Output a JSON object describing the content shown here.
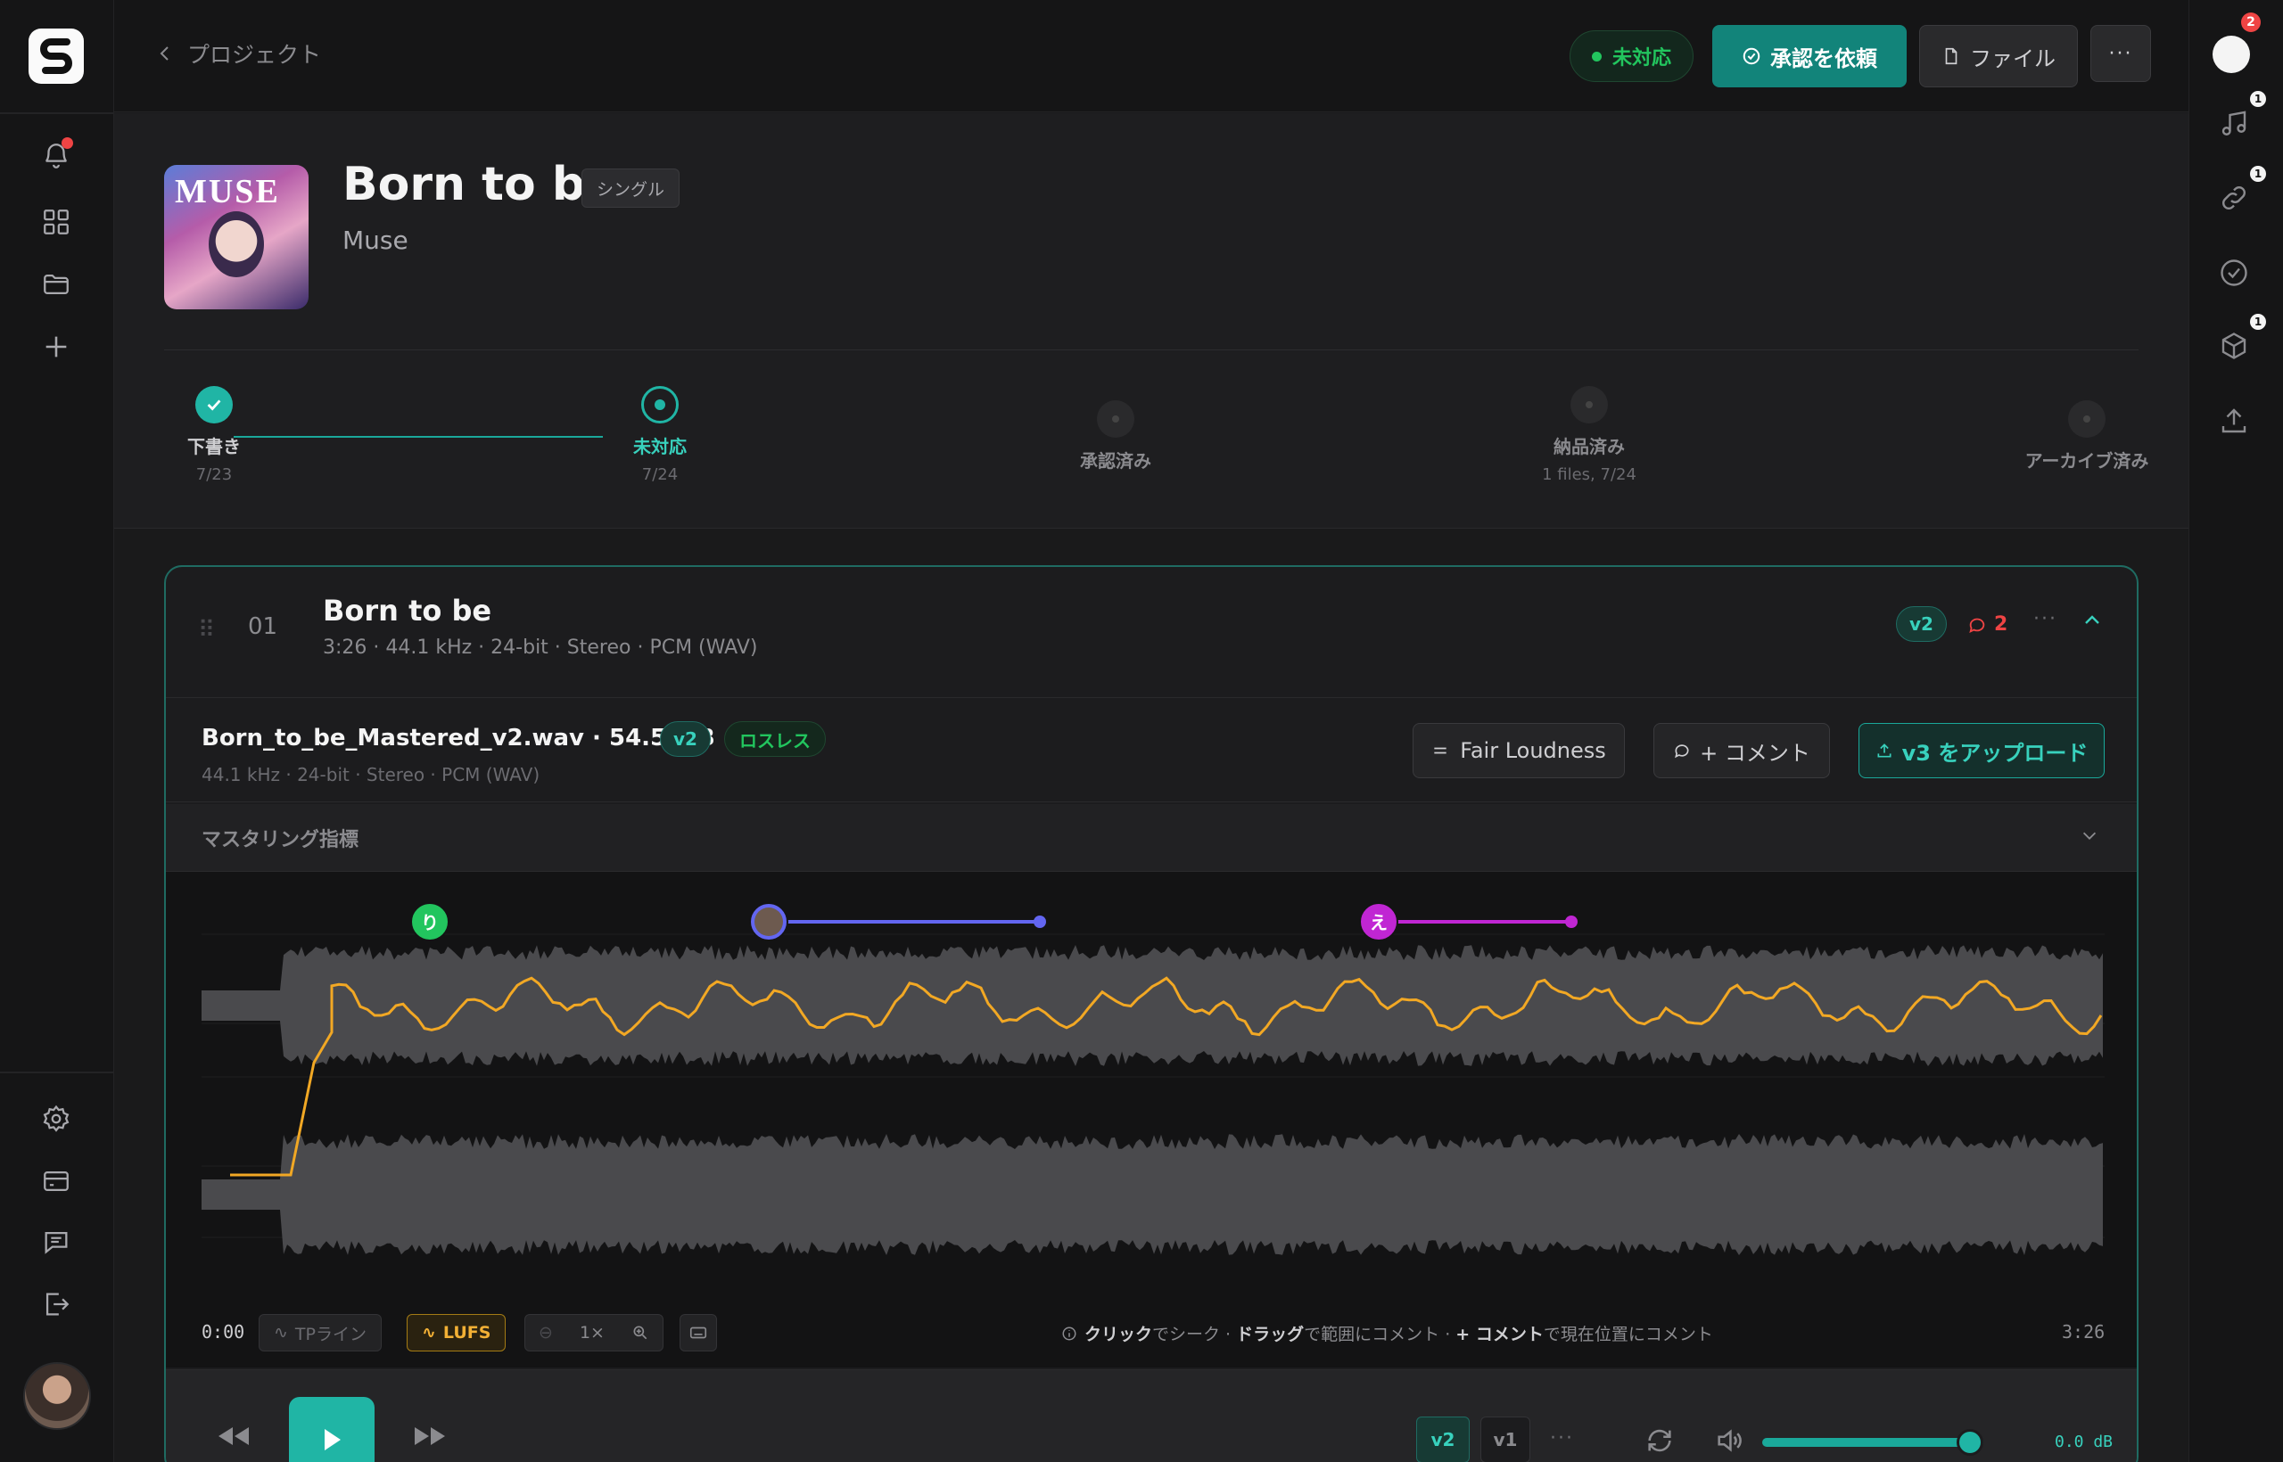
{
  "header": {
    "back_label": "プロジェクト",
    "status": "未対応",
    "approve_button": "承認を依頼",
    "file_button": "ファイル",
    "more_button": "···"
  },
  "right_rail": {
    "badges": {
      "profile": "2",
      "music": "1",
      "link": "1",
      "box": "1"
    }
  },
  "project": {
    "title": "Born to be",
    "type": "シングル",
    "artist": "Muse",
    "cover_text": "MUSE",
    "stages": [
      {
        "label": "下書き",
        "date": "7/23"
      },
      {
        "label": "未対応",
        "date": "7/24"
      },
      {
        "label": "承認済み",
        "date": ""
      },
      {
        "label": "納品済み",
        "date": "1 files, 7/24"
      },
      {
        "label": "アーカイブ済み",
        "date": ""
      }
    ]
  },
  "track": {
    "number": "01",
    "title": "Born to be",
    "meta": "3:26 · 44.1 kHz · 24-bit · Stereo · PCM (WAV)",
    "version": "v2",
    "comment_count": "2",
    "more": "···",
    "file": {
      "name": "Born_to_be_Mastered_v2.wav · 54.5 MB",
      "version": "v2",
      "lossless": "ロスレス",
      "meta": "44.1 kHz · 24-bit · Stereo · PCM (WAV)"
    },
    "fair_loudness_button": "Fair Loudness",
    "comment_button": "+ コメント",
    "upload_button": "v3 をアップロード",
    "metrics_label": "マスタリング指標",
    "markers": [
      {
        "letter": "り",
        "color": "#22c55e"
      },
      {
        "letter": "",
        "color": "#6366f1"
      },
      {
        "letter": "え",
        "color": "#c026d3"
      }
    ],
    "controls": {
      "time_start": "0:00",
      "tp_line": "TPライン",
      "lufs": "LUFS",
      "zoom": "1×",
      "hint_click": "クリック",
      "hint_seek": "でシーク · ",
      "hint_drag": "ドラッグ",
      "hint_range": "で範囲にコメント · ",
      "hint_comment": "+ コメント",
      "hint_current": "で現在位置にコメント",
      "time_end": "3:26"
    },
    "player": {
      "version_current": "v2",
      "version_prev": "v1",
      "more": "···",
      "volume_db": "0.0 dB",
      "volume_level": 0.94
    }
  },
  "colors": {
    "accent": "#20b5a5",
    "status_green": "#22c55e",
    "lufs_orange": "#f2b035",
    "alert_red": "#ef4444"
  }
}
